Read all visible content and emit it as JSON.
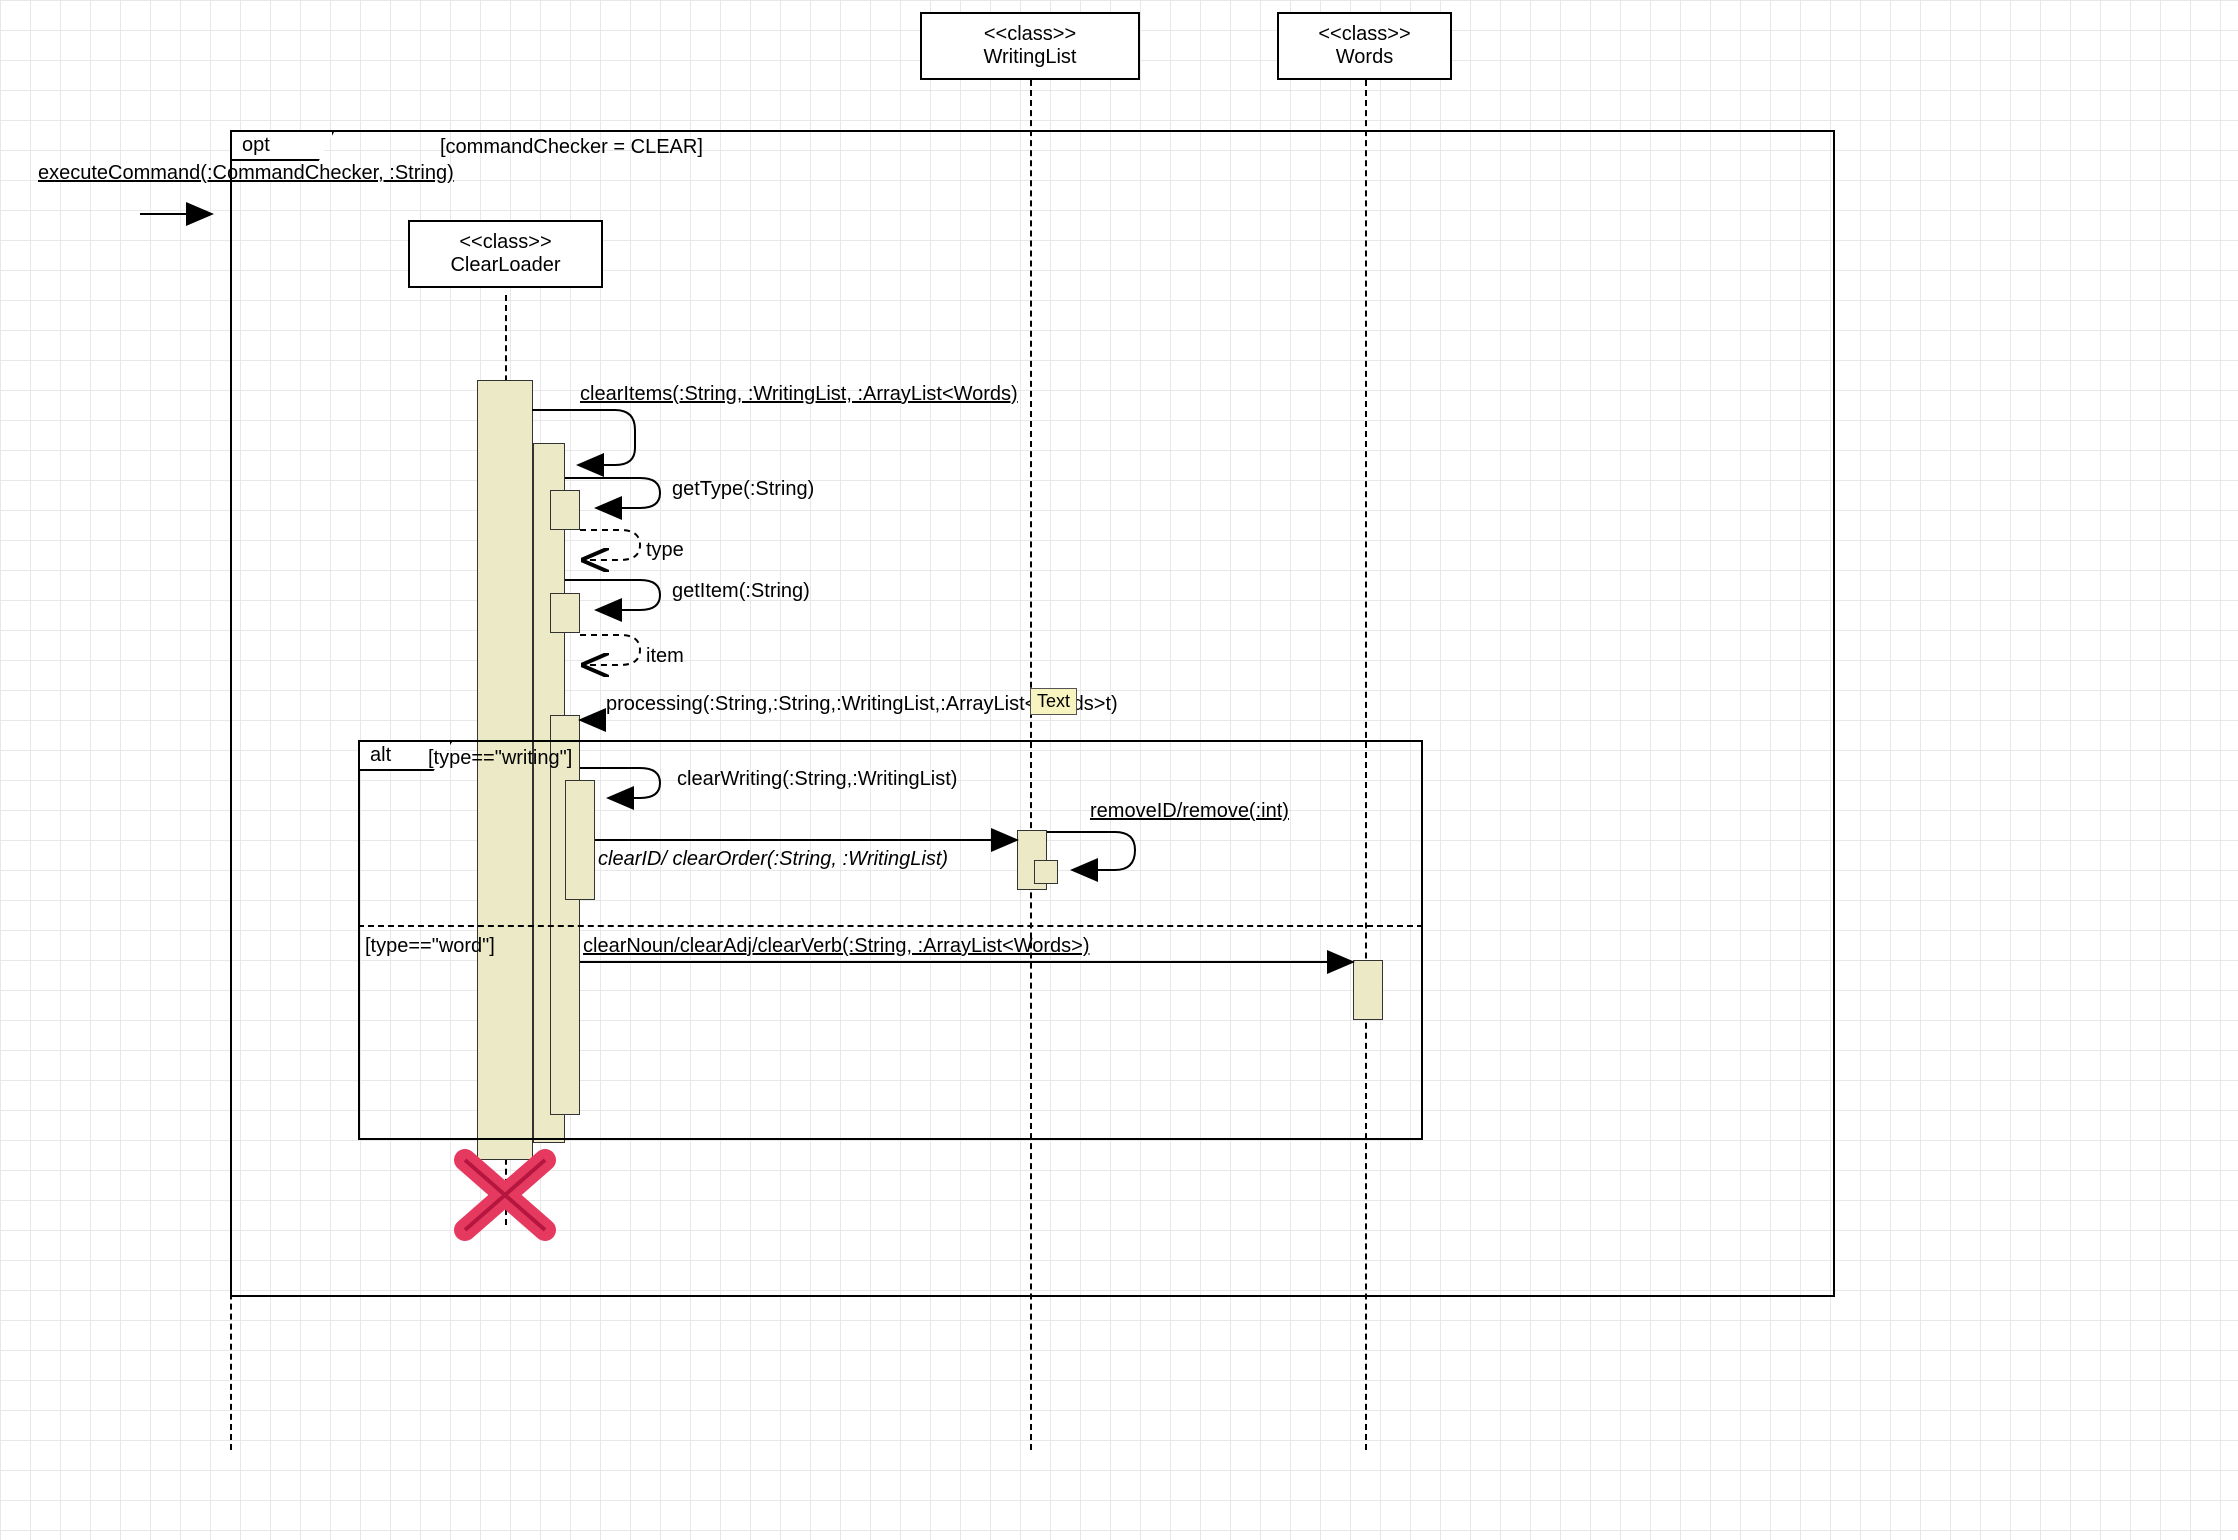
{
  "lifelines": {
    "writingList": {
      "stereotype": "<<class>>",
      "name": "WritingList"
    },
    "words": {
      "stereotype": "<<class>>",
      "name": "Words"
    },
    "clearLoader": {
      "stereotype": "<<class>>",
      "name": "ClearLoader"
    }
  },
  "frames": {
    "opt": {
      "label": "opt",
      "guard": "[commandChecker = CLEAR]"
    },
    "alt": {
      "label": "alt",
      "guard1": "[type==\"writing\"]",
      "guard2": "[type==\"word\"]"
    }
  },
  "messages": {
    "executeCommand": "executeCommand(:CommandChecker, :String)",
    "clearItems": "clearItems(:String, :WritingList, :ArrayList<Words)",
    "getType": "getType(:String)",
    "typeReturn": "type",
    "getItem": "getItem(:String)",
    "itemReturn": "item",
    "processing": "processing(:String,:String,:WritingList,:ArrayList<Words>t)",
    "clearWriting": "clearWriting(:String,:WritingList)",
    "clearIDOrder": "clearID/ clearOrder(:String, :WritingList)",
    "removeID": "removeID/remove(:int)",
    "clearNoun": "clearNoun/clearAdj/clearVerb(:String, :ArrayList<Words>)"
  },
  "annotations": {
    "tooltipText": "Text"
  }
}
